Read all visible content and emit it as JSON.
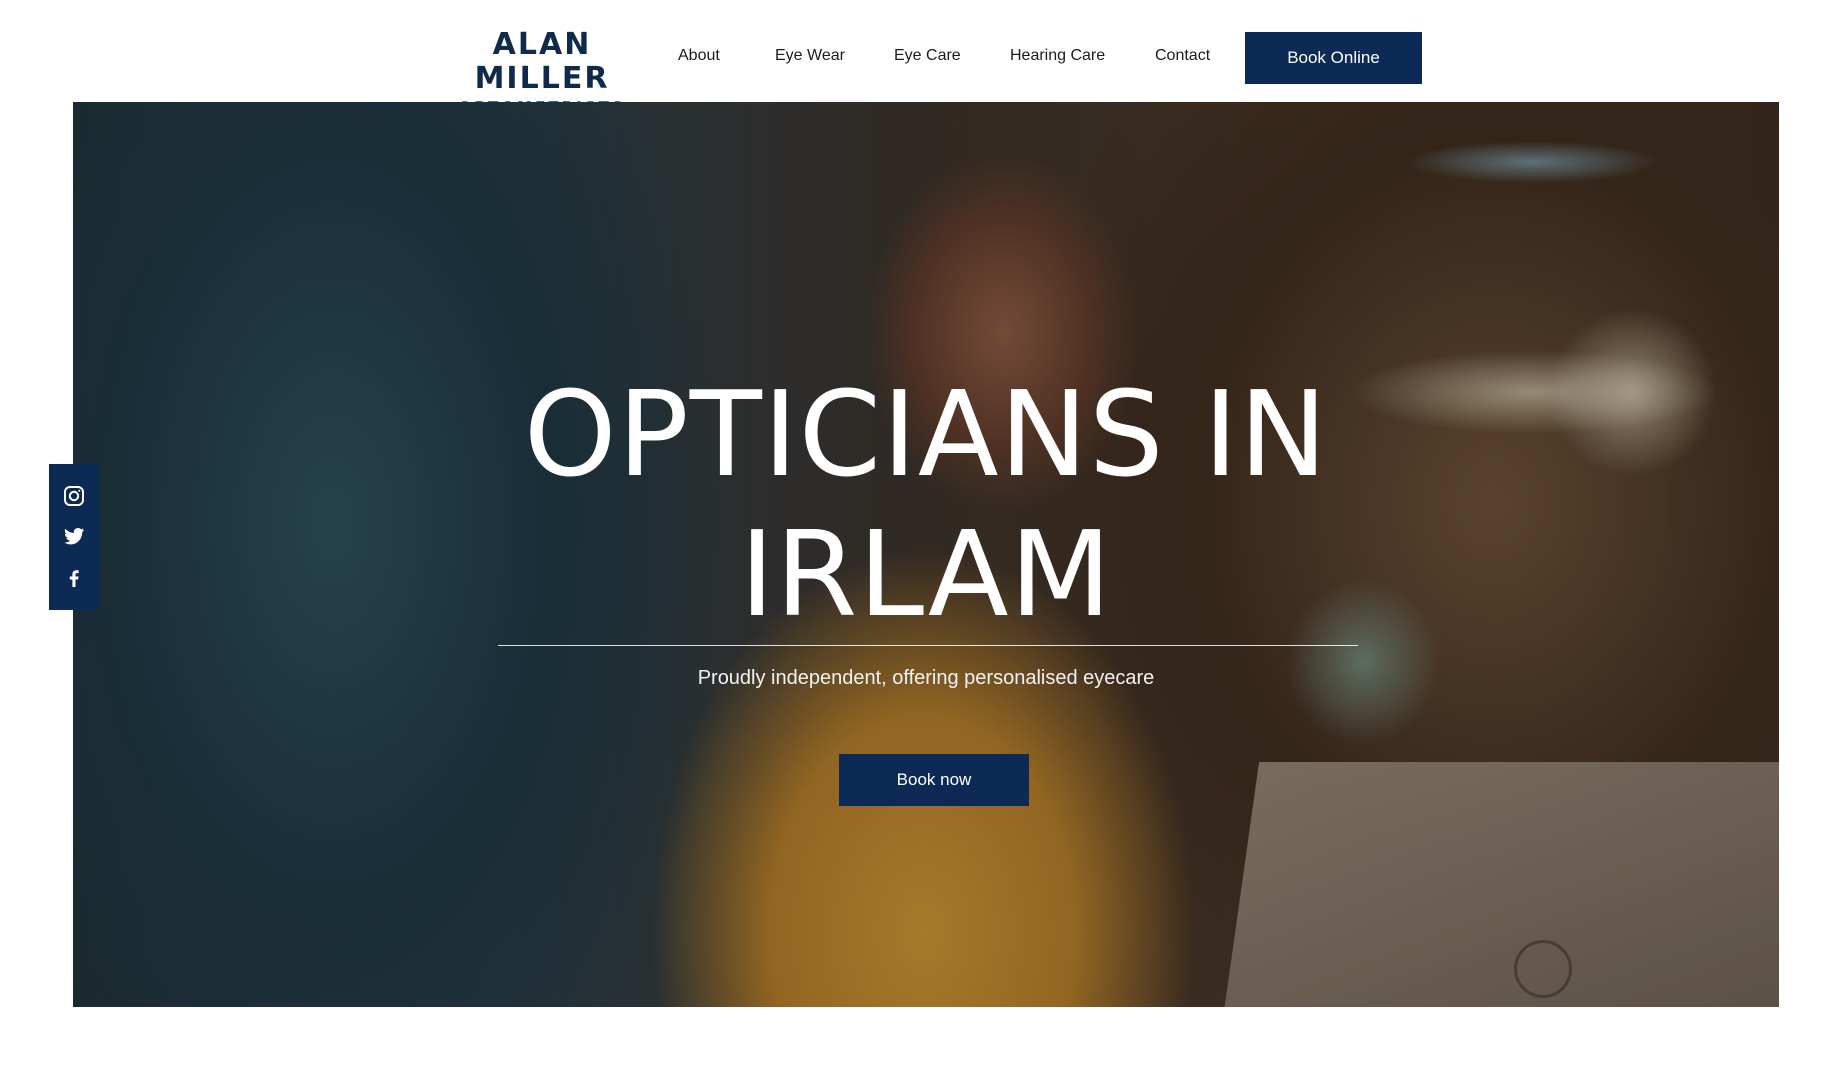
{
  "brand": {
    "name": "ALAN MILLER",
    "tagline": "OPTOMETRISTS",
    "primary_color": "#0c2a55",
    "accent_color": "#2f6fa8"
  },
  "nav": {
    "items": [
      {
        "label": "About"
      },
      {
        "label": "Eye Wear"
      },
      {
        "label": "Eye Care"
      },
      {
        "label": "Hearing Care"
      },
      {
        "label": "Contact"
      }
    ],
    "cta_label": "Book Online"
  },
  "hero": {
    "title_line1": "OPTICIANS IN",
    "title_line2": "IRLAM",
    "subtitle": "Proudly independent, offering personalised eyecare",
    "cta_label": "Book now"
  },
  "social": {
    "icons": [
      "instagram-icon",
      "twitter-icon",
      "facebook-icon"
    ]
  }
}
